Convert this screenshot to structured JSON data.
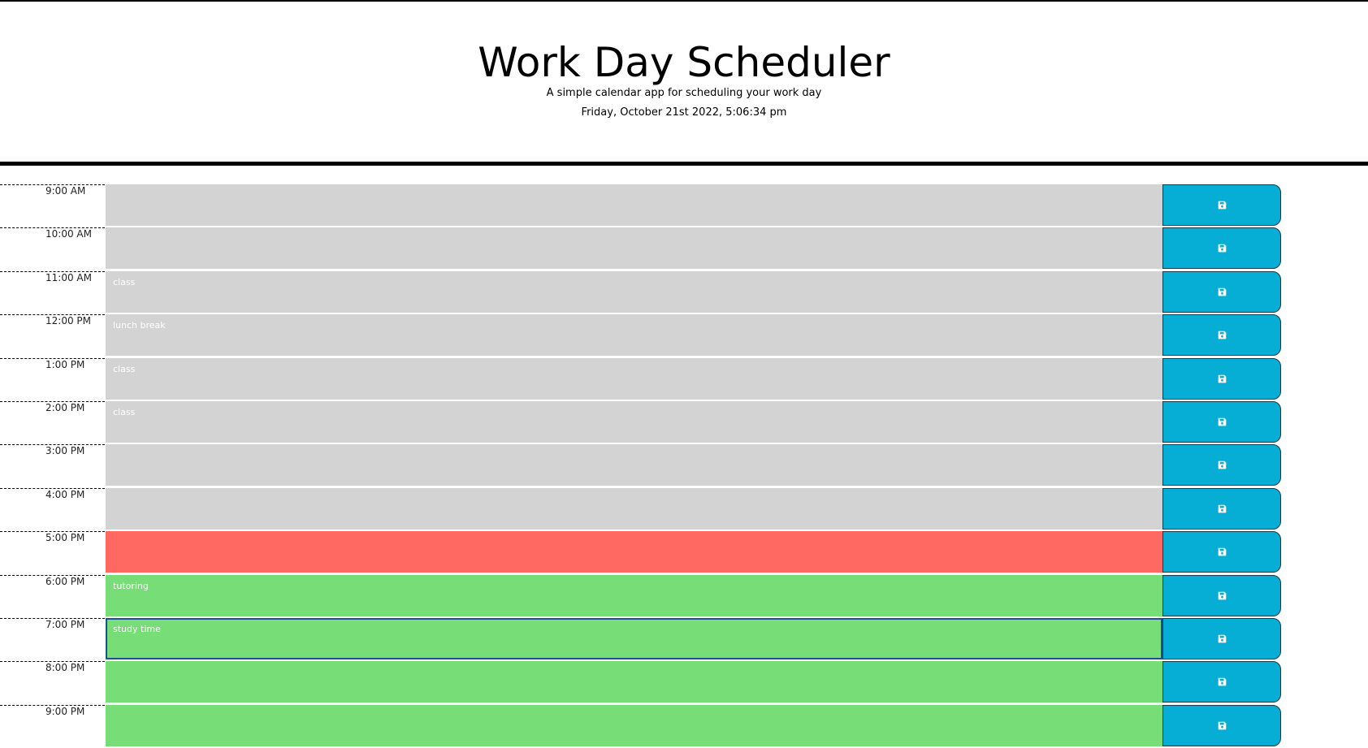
{
  "header": {
    "title": "Work Day Scheduler",
    "subtitle": "A simple calendar app for scheduling your work day",
    "current_datetime": "Friday, October 21st 2022, 5:06:34 pm"
  },
  "colors": {
    "past": "#d3d3d3",
    "present": "#ff6961",
    "future": "#77dd77",
    "save_button": "#06aed5"
  },
  "time_blocks": [
    {
      "hour": "9:00 AM",
      "text": "",
      "state": "past"
    },
    {
      "hour": "10:00 AM",
      "text": "",
      "state": "past"
    },
    {
      "hour": "11:00 AM",
      "text": "class",
      "state": "past"
    },
    {
      "hour": "12:00 PM",
      "text": "lunch break",
      "state": "past"
    },
    {
      "hour": "1:00 PM",
      "text": "class",
      "state": "past"
    },
    {
      "hour": "2:00 PM",
      "text": "class",
      "state": "past"
    },
    {
      "hour": "3:00 PM",
      "text": "",
      "state": "past"
    },
    {
      "hour": "4:00 PM",
      "text": "",
      "state": "past"
    },
    {
      "hour": "5:00 PM",
      "text": "",
      "state": "present"
    },
    {
      "hour": "6:00 PM",
      "text": "tutoring",
      "state": "future"
    },
    {
      "hour": "7:00 PM",
      "text": "study time",
      "state": "future",
      "focused": true
    },
    {
      "hour": "8:00 PM",
      "text": "",
      "state": "future"
    },
    {
      "hour": "9:00 PM",
      "text": "",
      "state": "future"
    }
  ],
  "save_icon": "save-icon"
}
